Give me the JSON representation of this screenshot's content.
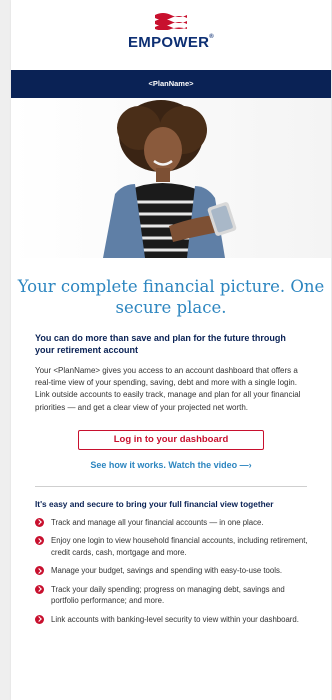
{
  "header": {
    "brand": "EMPOWER",
    "brand_mark": "®",
    "plan_name": "<PlanName>"
  },
  "colors": {
    "navy": "#0a2255",
    "accent_blue": "#2d86c0",
    "brand_red": "#c8102e"
  },
  "hero": {
    "image_icon": "woman-with-phone-photo"
  },
  "main": {
    "headline": "Your complete financial picture. One secure place.",
    "subhead": "You can do more than save and plan for the future through your retirement account",
    "body": "Your <PlanName> gives you access to an account dashboard that offers a real-time view of your spending, saving, debt and more with a single login. Link outside accounts to easily track, manage and plan for all your financial priorities — and get a clear view of your projected net worth.",
    "login_button": "Log in to your dashboard",
    "video_link": "See how it works. Watch the video —›"
  },
  "features": {
    "title": "It's easy and secure to bring your full financial view together",
    "items": [
      "Track and manage all your financial accounts — in one place.",
      "Enjoy one login to view household financial accounts, including retirement, credit cards, cash, mortgage and more.",
      "Manage your budget, savings and spending with easy-to-use tools.",
      "Track your daily spending; progress on managing debt, savings and portfolio performance; and more.",
      "Link accounts with banking-level security to view within your dashboard."
    ]
  }
}
